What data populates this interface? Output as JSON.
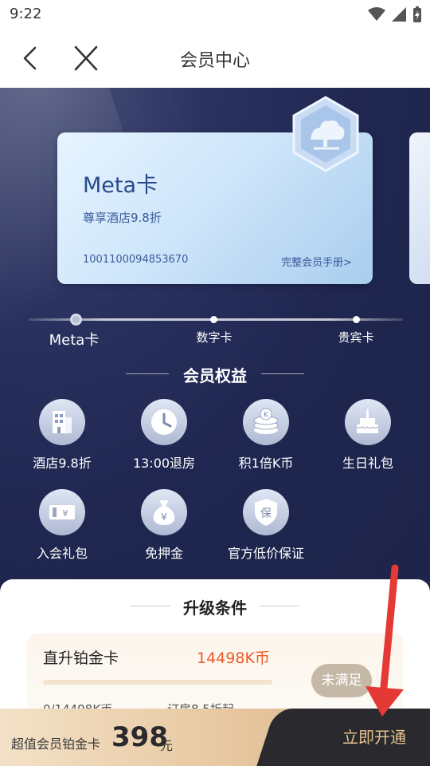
{
  "status_bar": {
    "time": "9:22"
  },
  "header": {
    "title": "会员中心"
  },
  "card": {
    "name": "Meta卡",
    "description": "尊享酒店9.8折",
    "number": "1001100094853670",
    "handbook_link": "完整会员手册>"
  },
  "levels": [
    {
      "label": "Meta卡",
      "active": true
    },
    {
      "label": "数字卡",
      "active": false
    },
    {
      "label": "贵宾卡",
      "active": false
    }
  ],
  "benefits": {
    "title": "会员权益",
    "items": [
      {
        "label": "酒店9.8折",
        "icon": "hotel-icon"
      },
      {
        "label": "13:00退房",
        "icon": "clock-icon"
      },
      {
        "label": "积1倍K币",
        "icon": "coins-icon"
      },
      {
        "label": "生日礼包",
        "icon": "cake-icon"
      },
      {
        "label": "入会礼包",
        "icon": "ticket-icon"
      },
      {
        "label": "免押金",
        "icon": "money-bag-icon"
      },
      {
        "label": "官方低价保证",
        "icon": "shield-icon"
      }
    ]
  },
  "upgrade": {
    "title": "升级条件",
    "name": "直升铂金卡",
    "points": "14498K币",
    "status": "未满足",
    "progress_text": "0/14498K币",
    "progress": 0,
    "discount": "订房8.5折起"
  },
  "bottom_bar": {
    "label": "超值会员铂金卡",
    "price": "398",
    "unit": "元",
    "button": "立即开通"
  },
  "colors": {
    "accent": "#f05a2a",
    "hero_bg": "#1f2650",
    "annotation": "#e53935"
  }
}
